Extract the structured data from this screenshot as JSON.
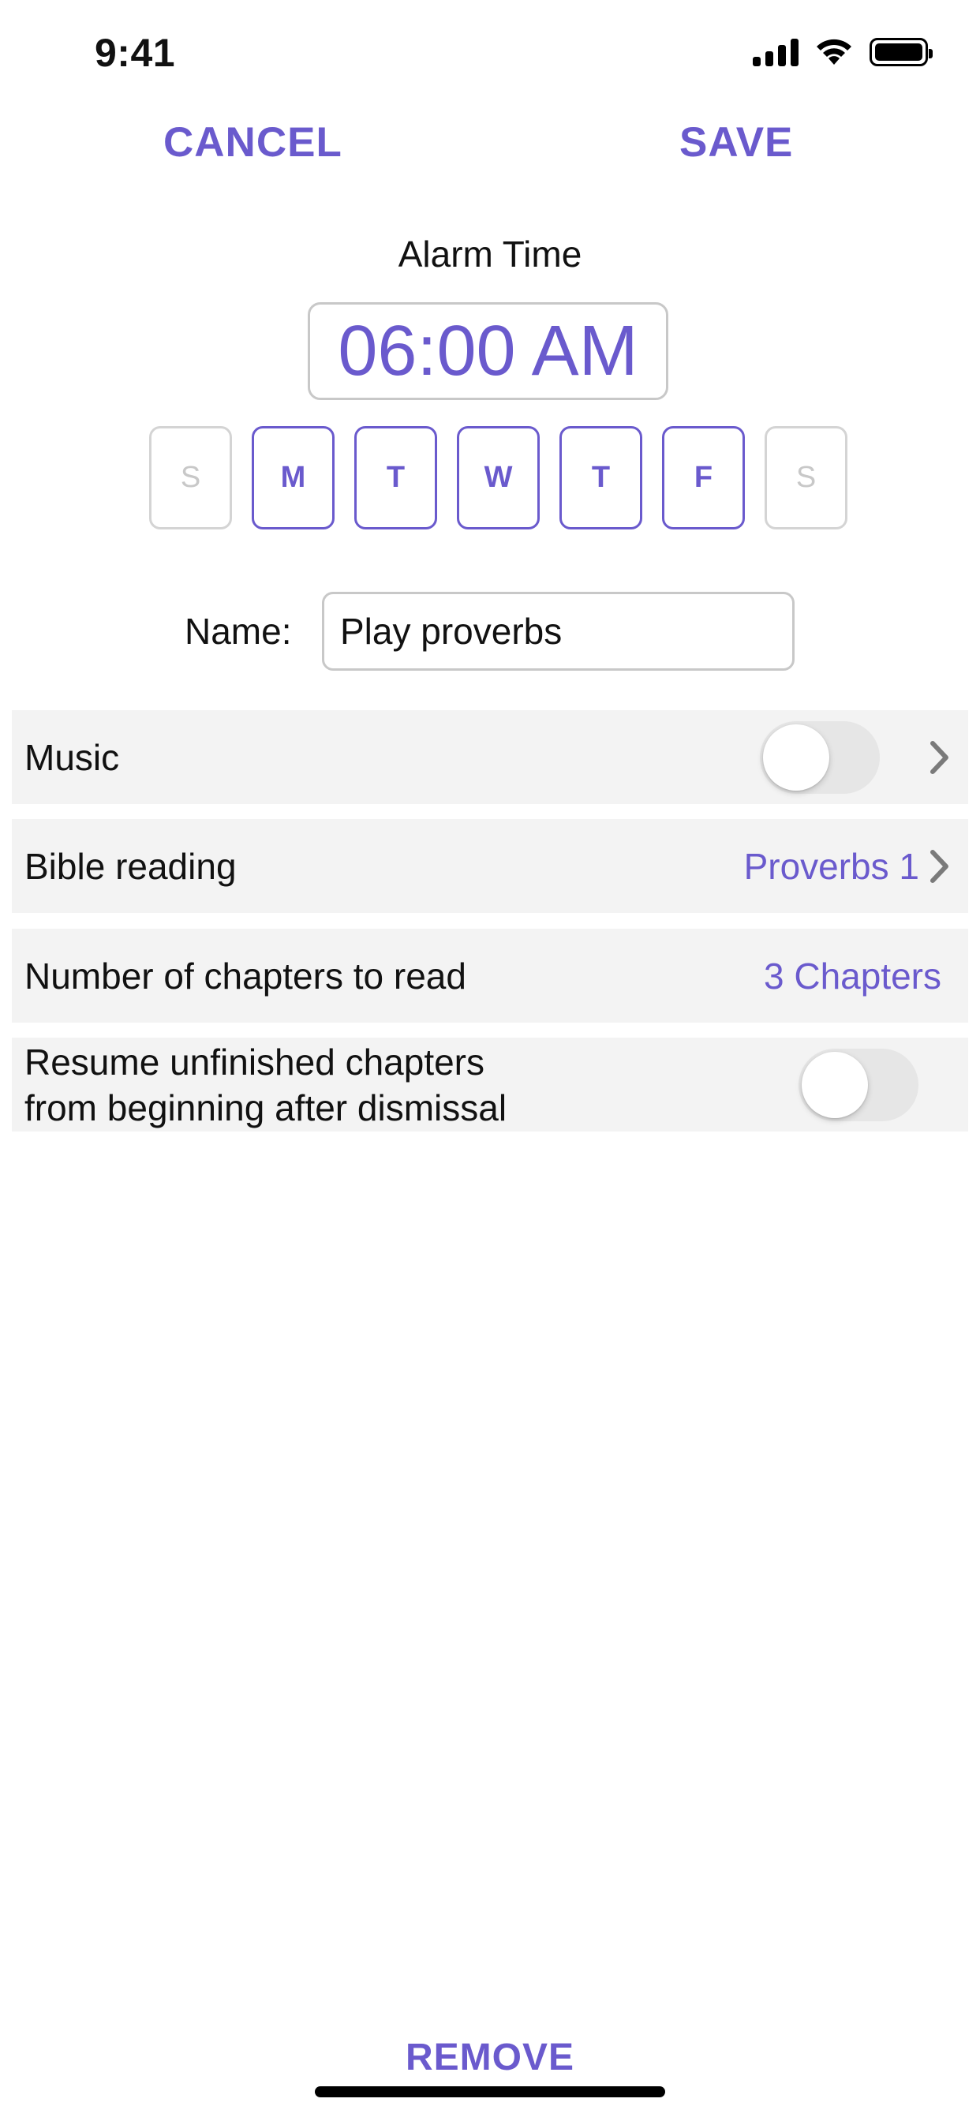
{
  "status_bar": {
    "time": "9:41",
    "icons": [
      "cellular-signal-icon",
      "wifi-icon",
      "battery-icon"
    ]
  },
  "header": {
    "cancel_label": "CANCEL",
    "save_label": "SAVE"
  },
  "alarm": {
    "label": "Alarm Time",
    "time": "06:00 AM"
  },
  "days": [
    {
      "label": "S",
      "selected": false
    },
    {
      "label": "M",
      "selected": true
    },
    {
      "label": "T",
      "selected": true
    },
    {
      "label": "W",
      "selected": true
    },
    {
      "label": "T",
      "selected": true
    },
    {
      "label": "F",
      "selected": true
    },
    {
      "label": "S",
      "selected": false
    }
  ],
  "name": {
    "label": "Name:",
    "value": "Play proverbs"
  },
  "settings": {
    "music": {
      "label": "Music",
      "enabled": false
    },
    "bible_reading": {
      "label": "Bible reading",
      "value": "Proverbs 1"
    },
    "chapters": {
      "label": "Number of chapters to read",
      "value": "3 Chapters"
    },
    "resume": {
      "label_line1": "Resume unfinished chapters",
      "label_line2": "from beginning after dismissal",
      "enabled": false
    }
  },
  "footer": {
    "remove_label": "REMOVE"
  },
  "colors": {
    "accent": "#6a5acd",
    "row_background": "#f3f3f3",
    "toggle_off": "#e6e6e6",
    "inactive_day": "#c8c8c8"
  }
}
